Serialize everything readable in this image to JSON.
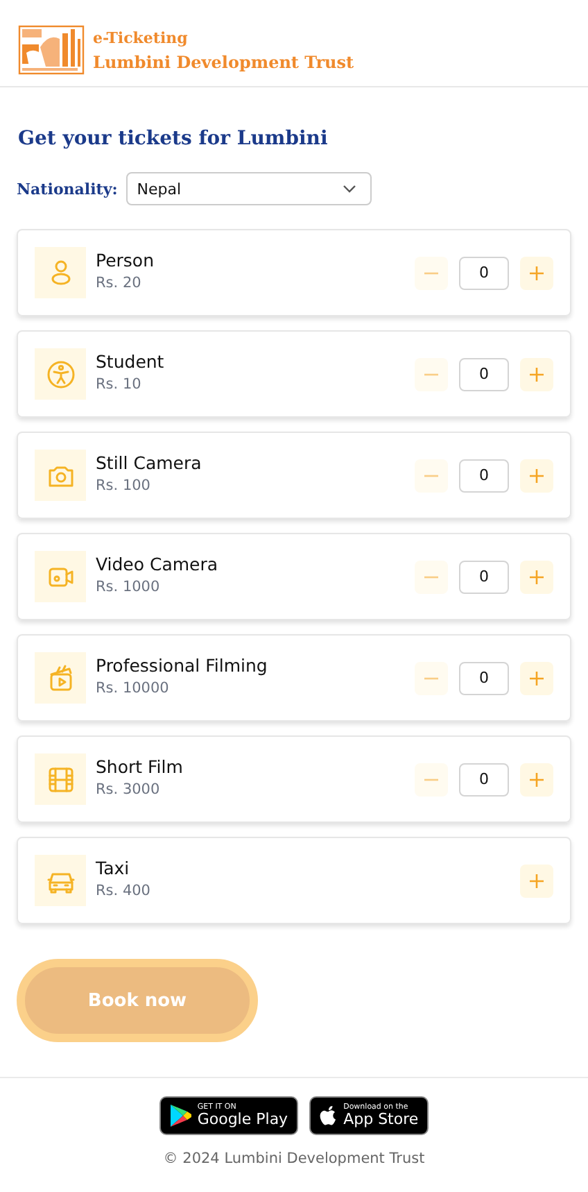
{
  "header": {
    "subtitle": "e-Ticketing",
    "title": "Lumbini Development Trust"
  },
  "heading": "Get your tickets for Lumbini",
  "nationality": {
    "label": "Nationality:",
    "value": "Nepal"
  },
  "tickets": [
    {
      "kind": "counter",
      "name": "Person",
      "price": "Rs. 20",
      "count": "0",
      "minus_disabled": true
    },
    {
      "kind": "counter",
      "name": "Student",
      "price": "Rs. 10",
      "count": "0",
      "minus_disabled": true
    },
    {
      "kind": "counter",
      "name": "Still Camera",
      "price": "Rs. 100",
      "count": "0",
      "minus_disabled": true
    },
    {
      "kind": "counter",
      "name": "Video Camera",
      "price": "Rs. 1000",
      "count": "0",
      "minus_disabled": true
    },
    {
      "kind": "counter",
      "name": "Professional Filming",
      "price": "Rs. 10000",
      "count": "0",
      "minus_disabled": true
    },
    {
      "kind": "counter",
      "name": "Short Film",
      "price": "Rs. 3000",
      "count": "0",
      "minus_disabled": true
    },
    {
      "kind": "add",
      "name": "Taxi",
      "price": "Rs. 400"
    }
  ],
  "book_button": {
    "label": "Book now",
    "disabled": true
  },
  "stores": [
    {
      "kind": "google",
      "small": "GET IT ON",
      "big": "Google Play"
    },
    {
      "kind": "apple",
      "small": "Download on the",
      "big": "App Store"
    }
  ],
  "copyright": "© 2024 Lumbini Development Trust"
}
